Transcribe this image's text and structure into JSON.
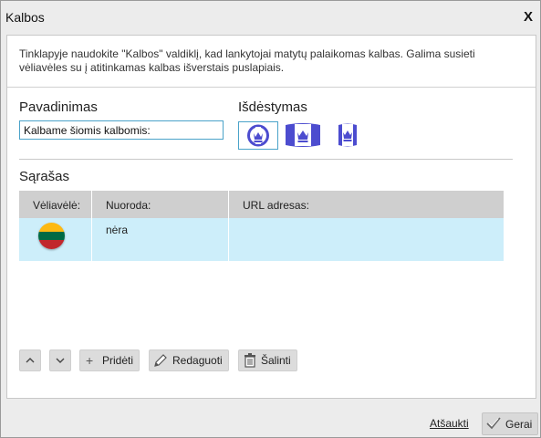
{
  "dialog": {
    "title": "Kalbos",
    "close_label": "X"
  },
  "description": "Tinklapyje naudokite \"Kalbos\" valdiklį, kad lankytojai matytų palaikomas kalbas. Galima susieti vėliavėles su į atitinkamas kalbas išverstais puslapiais.",
  "name_section": {
    "label": "Pavadinimas",
    "value": "Kalbame šiomis kalbomis:"
  },
  "layout_section": {
    "label": "Išdėstymas",
    "options": [
      "round-flag",
      "wide-flag",
      "narrow-flag"
    ],
    "selected": "round-flag"
  },
  "list_section": {
    "label": "Sąrašas",
    "columns": [
      "Vėliavėlė:",
      "Nuoroda:",
      "URL adresas:"
    ],
    "rows": [
      {
        "flag": "lithuania-flag-icon",
        "link": "nėra",
        "url": ""
      }
    ],
    "flag_colors": [
      "#fdb913",
      "#006a44",
      "#c1272d"
    ]
  },
  "toolbar": {
    "up_icon": "chevron-up-icon",
    "down_icon": "chevron-down-icon",
    "add_label": "Pridėti",
    "edit_label": "Redaguoti",
    "delete_label": "Šalinti"
  },
  "footer": {
    "cancel_label": "Atšaukti",
    "ok_label": "Gerai"
  },
  "colors": {
    "accent": "#4aa3c9",
    "row_selected": "#cdeefa",
    "header_bg": "#cfcfcf",
    "icon_blue": "#4c4ccf"
  }
}
